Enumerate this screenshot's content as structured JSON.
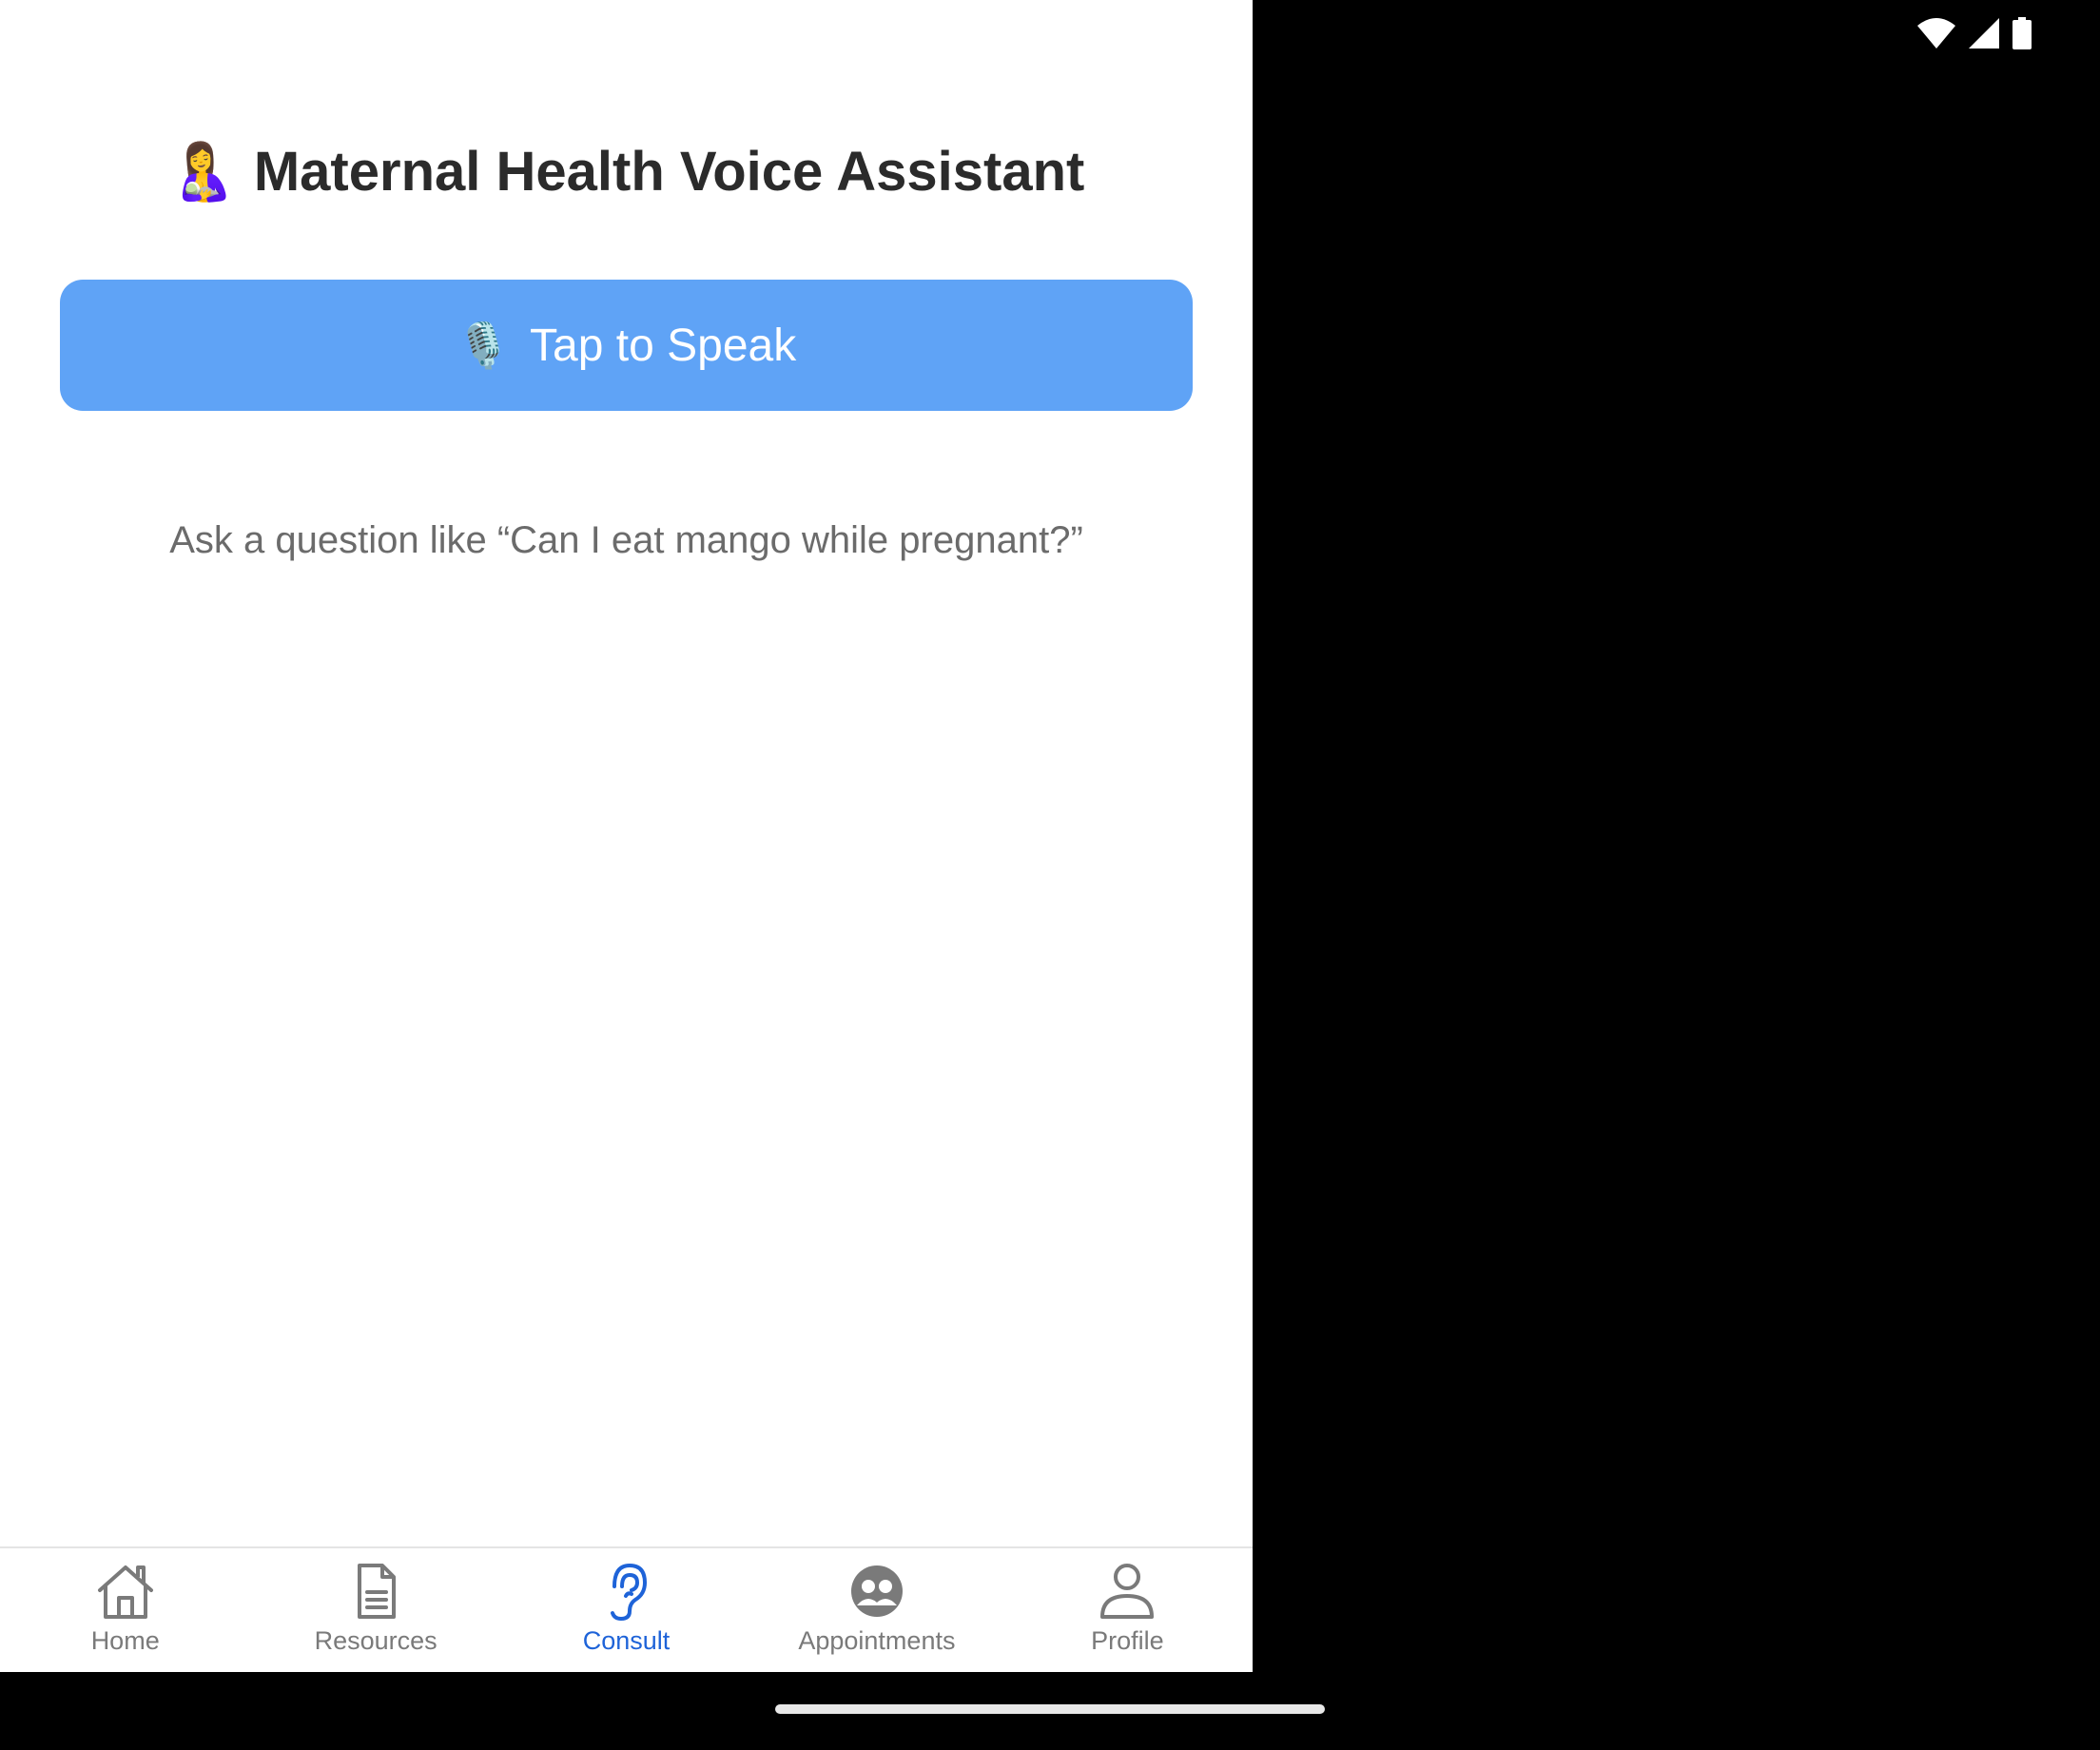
{
  "status_bar": {
    "icons": [
      "wifi-icon",
      "cell-signal-icon",
      "battery-icon"
    ]
  },
  "header": {
    "emoji": "🤱",
    "title": "Maternal Health Voice Assistant"
  },
  "speak_button": {
    "emoji": "🎙️",
    "label": "Tap to Speak"
  },
  "hint": {
    "text": "Ask a question like “Can I eat mango while pregnant?”"
  },
  "tabs": [
    {
      "label": "Home",
      "icon": "home-icon",
      "active": false
    },
    {
      "label": "Resources",
      "icon": "document-icon",
      "active": false
    },
    {
      "label": "Consult",
      "icon": "ear-icon",
      "active": true
    },
    {
      "label": "Appointments",
      "icon": "people-circle-icon",
      "active": false
    },
    {
      "label": "Profile",
      "icon": "person-icon",
      "active": false
    }
  ],
  "colors": {
    "accent": "#1e63d8",
    "button": "#5fa3f6",
    "inactive": "#7a7a7a",
    "title": "#2b2b2b"
  }
}
